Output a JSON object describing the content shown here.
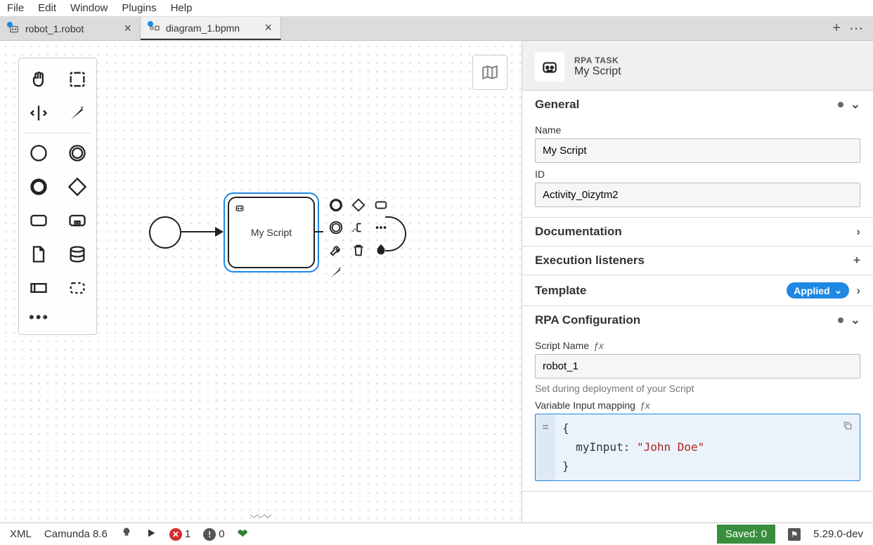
{
  "menu": {
    "items": [
      "File",
      "Edit",
      "Window",
      "Plugins",
      "Help"
    ]
  },
  "tabs": [
    {
      "label": "robot_1.robot",
      "active": false,
      "dirty": true
    },
    {
      "label": "diagram_1.bpmn",
      "active": true,
      "dirty": true
    }
  ],
  "canvas": {
    "task_label": "My Script"
  },
  "properties": {
    "type_label": "RPA TASK",
    "title": "My Script",
    "sections": {
      "general": {
        "heading": "General",
        "name": {
          "label": "Name",
          "value": "My Script"
        },
        "id": {
          "label": "ID",
          "value": "Activity_0izytm2"
        }
      },
      "documentation": {
        "heading": "Documentation"
      },
      "execution_listeners": {
        "heading": "Execution listeners"
      },
      "template": {
        "heading": "Template",
        "badge": "Applied"
      },
      "rpa_config": {
        "heading": "RPA Configuration",
        "script_name": {
          "label": "Script Name",
          "value": "robot_1",
          "help": "Set during deployment of your Script"
        },
        "var_input": {
          "label": "Variable Input mapping",
          "key": "myInput",
          "value": "\"John Doe\""
        }
      }
    }
  },
  "status": {
    "xml": "XML",
    "platform": "Camunda 8.6",
    "errors": "1",
    "warnings": "0",
    "saved": "Saved: 0",
    "version": "5.29.0-dev"
  }
}
